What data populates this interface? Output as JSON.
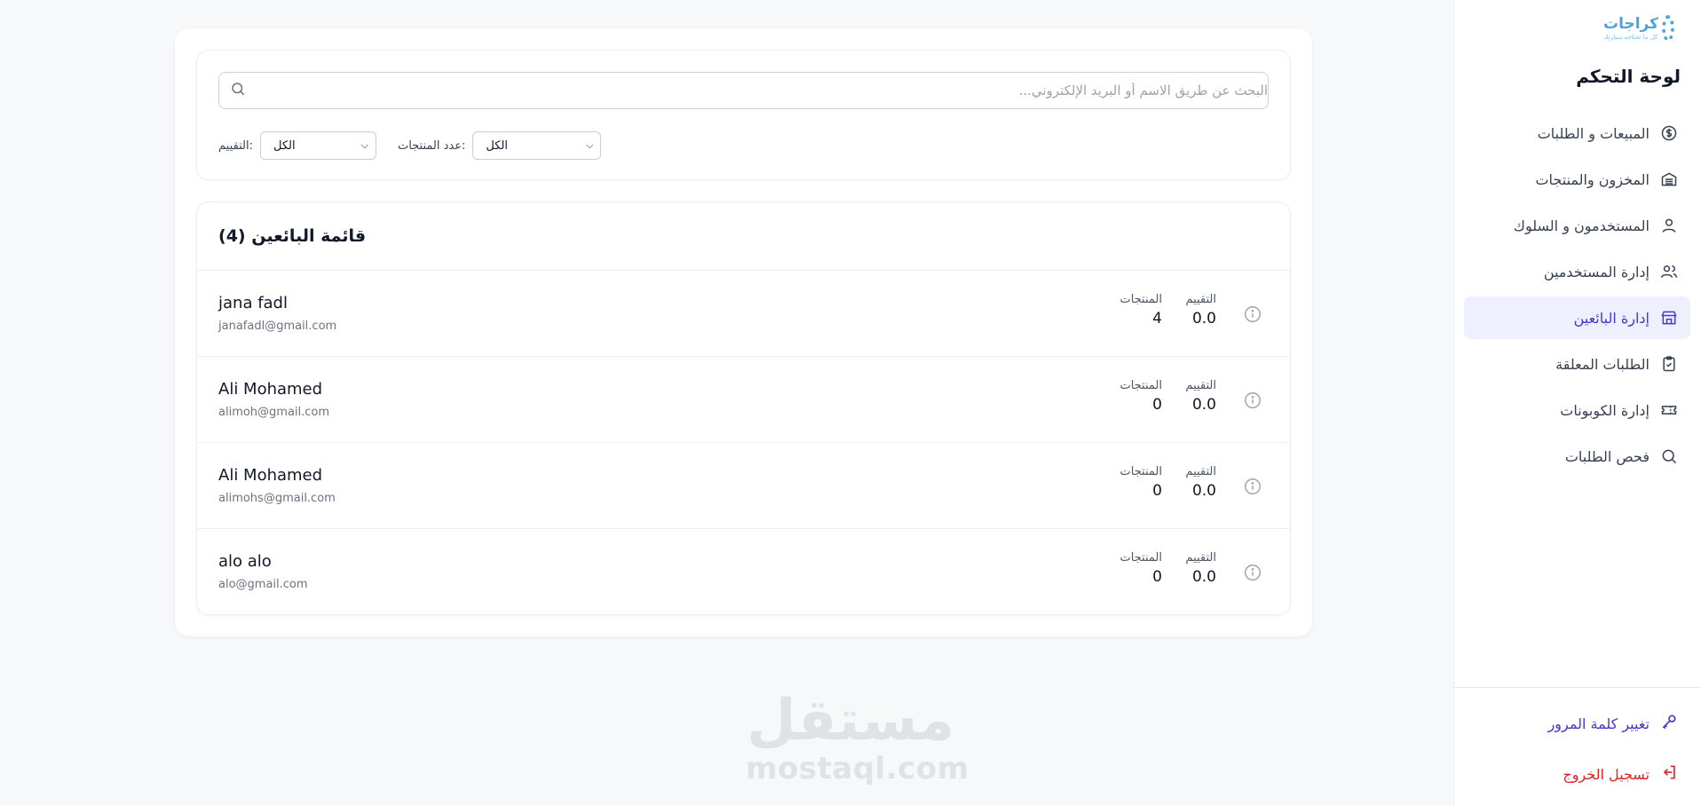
{
  "brand": {
    "name": "كراجات",
    "tagline": "كل ما تحتاجه سيارتك"
  },
  "sidebar": {
    "title": "لوحة التحكم",
    "items": [
      {
        "label": "المبيعات و الطلبات",
        "icon": "dollar-circle-icon"
      },
      {
        "label": "المخزون والمنتجات",
        "icon": "warehouse-icon"
      },
      {
        "label": "المستخدمون و السلوك",
        "icon": "user-icon"
      },
      {
        "label": "إدارة المستخدمين",
        "icon": "users-icon"
      },
      {
        "label": "إدارة البائعين",
        "icon": "store-icon",
        "active": true
      },
      {
        "label": "الطلبات المعلقة",
        "icon": "clipboard-check-icon"
      },
      {
        "label": "إدارة الكوبونات",
        "icon": "ticket-icon"
      },
      {
        "label": "فحص الطلبات",
        "icon": "search-icon"
      }
    ],
    "change_password": "تغيير كلمة المرور",
    "logout": "تسجيل الخروج"
  },
  "search": {
    "placeholder": "البحث عن طريق الاسم أو البريد الإلكتروني..."
  },
  "filters": {
    "products_label": "عدد المنتجات:",
    "products_value": "الكل",
    "rating_label": "التقييم:",
    "rating_value": "الكل"
  },
  "list": {
    "title": "قائمة البائعين (4)",
    "rating_header": "التقييم",
    "products_header": "المنتجات",
    "sellers": [
      {
        "name": "jana fadl",
        "email": "janafadl@gmail.com",
        "rating": "0.0",
        "products": "4"
      },
      {
        "name": "Ali Mohamed",
        "email": "alimoh@gmail.com",
        "rating": "0.0",
        "products": "0"
      },
      {
        "name": "Ali Mohamed",
        "email": "alimohs@gmail.com",
        "rating": "0.0",
        "products": "0"
      },
      {
        "name": "alo alo",
        "email": "alo@gmail.com",
        "rating": "0.0",
        "products": "0"
      }
    ]
  },
  "watermark": {
    "ar": "مستقل",
    "en": "mostaql.com"
  },
  "colors": {
    "accent": "#4338ca",
    "active_bg": "#eef0fe",
    "danger": "#dc2626",
    "logo": "#4aa3df"
  }
}
